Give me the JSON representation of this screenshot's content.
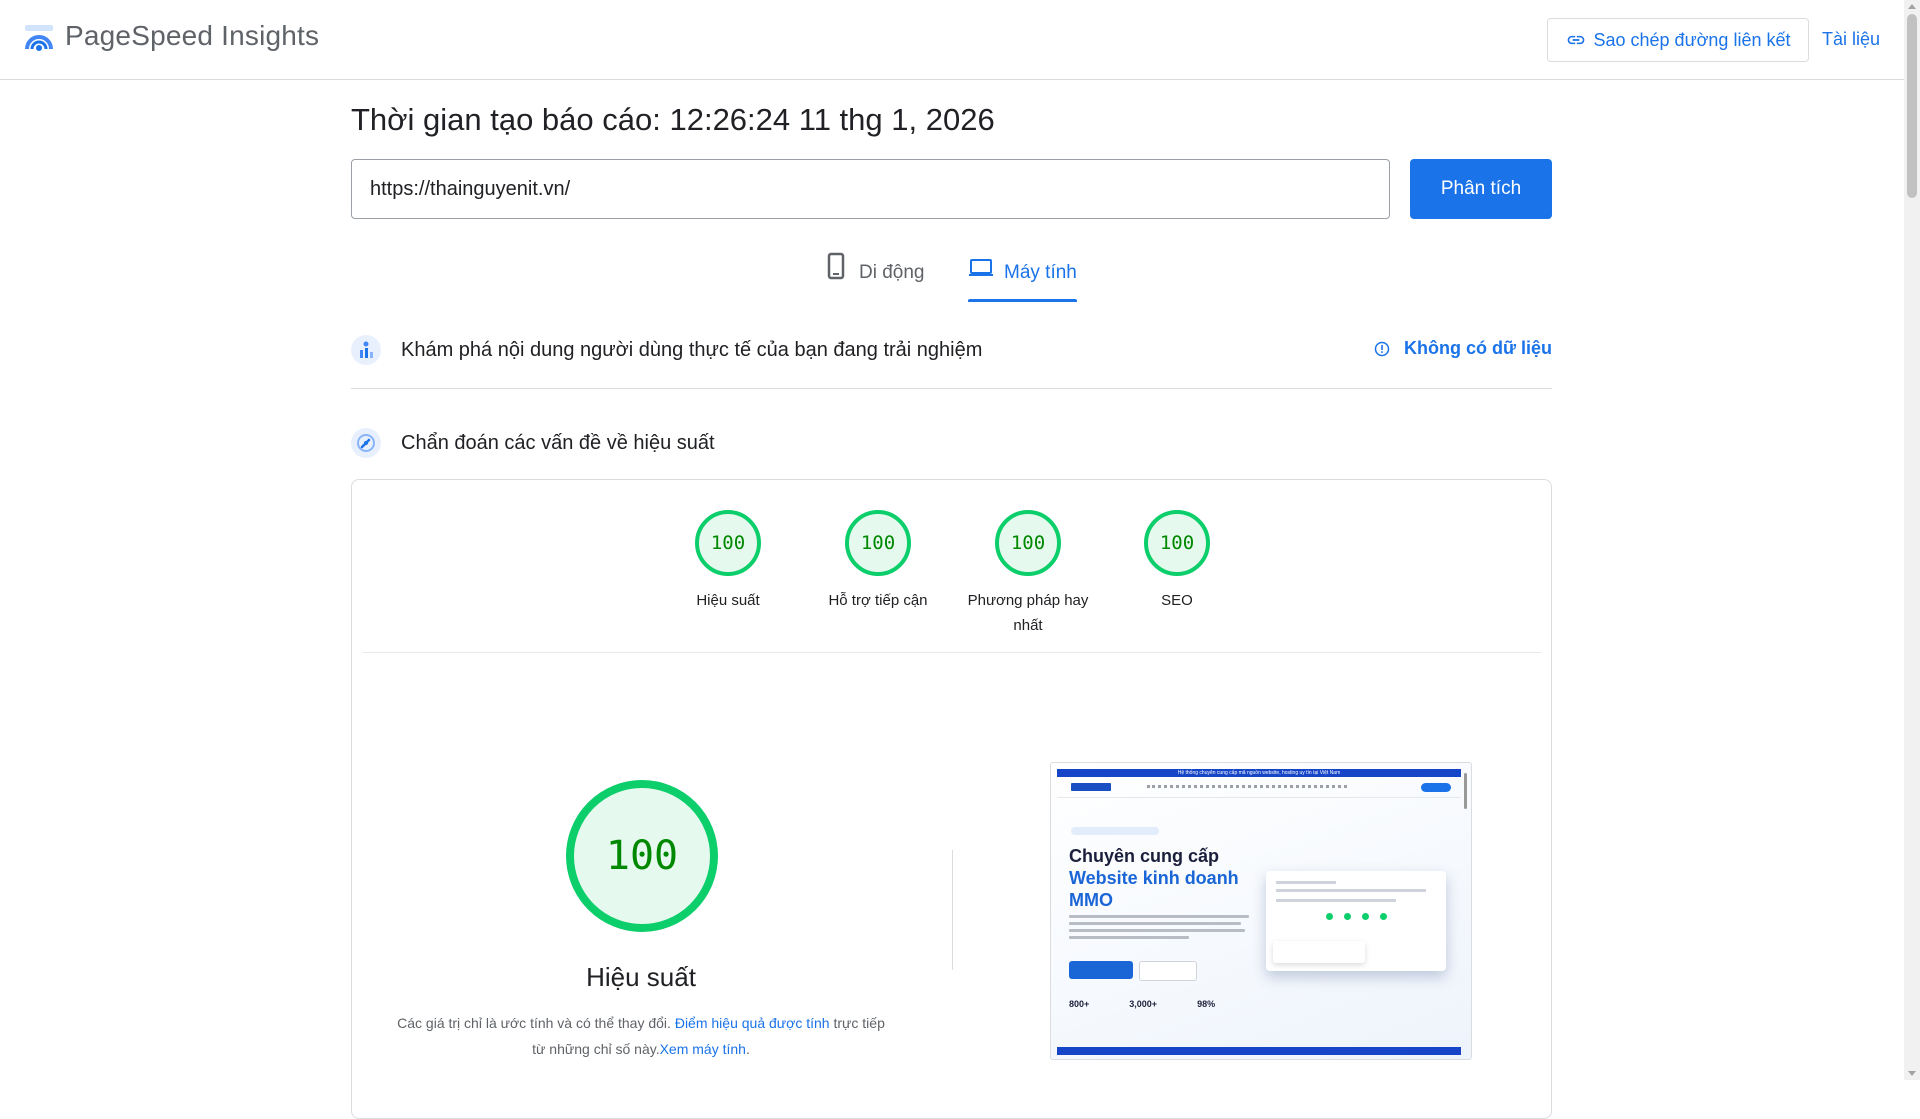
{
  "header": {
    "brand": "PageSpeed Insights",
    "copy_link_label": "Sao chép đường liên kết",
    "docs_label": "Tài liệu"
  },
  "report": {
    "time_label": "Thời gian tạo báo cáo: 12:26:24 11 thg 1, 2026",
    "url_value": "https://thainguyenit.vn/",
    "analyze_label": "Phân tích"
  },
  "tabs": [
    {
      "label": "Di động",
      "icon": "phone-icon",
      "active": false
    },
    {
      "label": "Máy tính",
      "icon": "laptop-icon",
      "active": true
    }
  ],
  "cwv": {
    "text": "Khám phá nội dung người dùng thực tế của bạn đang trải nghiệm",
    "no_data_label": "Không có dữ liệu"
  },
  "diagnostics": {
    "text": "Chẩn đoán các vấn đề về hiệu suất"
  },
  "scores": [
    {
      "label": "Hiệu suất",
      "value": "100"
    },
    {
      "label": "Hỗ trợ tiếp cận",
      "value": "100"
    },
    {
      "label": "Phương pháp hay nhất",
      "value": "100"
    },
    {
      "label": "SEO",
      "value": "100"
    }
  ],
  "performance": {
    "score": "100",
    "title": "Hiệu suất",
    "note_before": "Các giá trị chỉ là ước tính và có thể thay đổi. ",
    "note_link1": "Điểm hiệu quả được tính",
    "note_middle": " trực tiếp từ những chỉ số này.",
    "note_link2": "Xem máy tính",
    "note_end": "."
  },
  "thumbnail": {
    "top_bar": "Hệ thống chuyên cung cấp mã nguồn website, hosting uy tín tại Việt Nam",
    "heading_line1": "Chuyên cung cấp",
    "heading_line2": "Website kinh doanh",
    "heading_line3": "MMO",
    "stat1": "800+",
    "stat2": "3,000+",
    "stat3": "98%"
  },
  "colors": {
    "accent": "#1a73e8",
    "pass_green": "#0cce6b",
    "pass_fill": "#e6f9ee",
    "pass_text": "#008800"
  }
}
